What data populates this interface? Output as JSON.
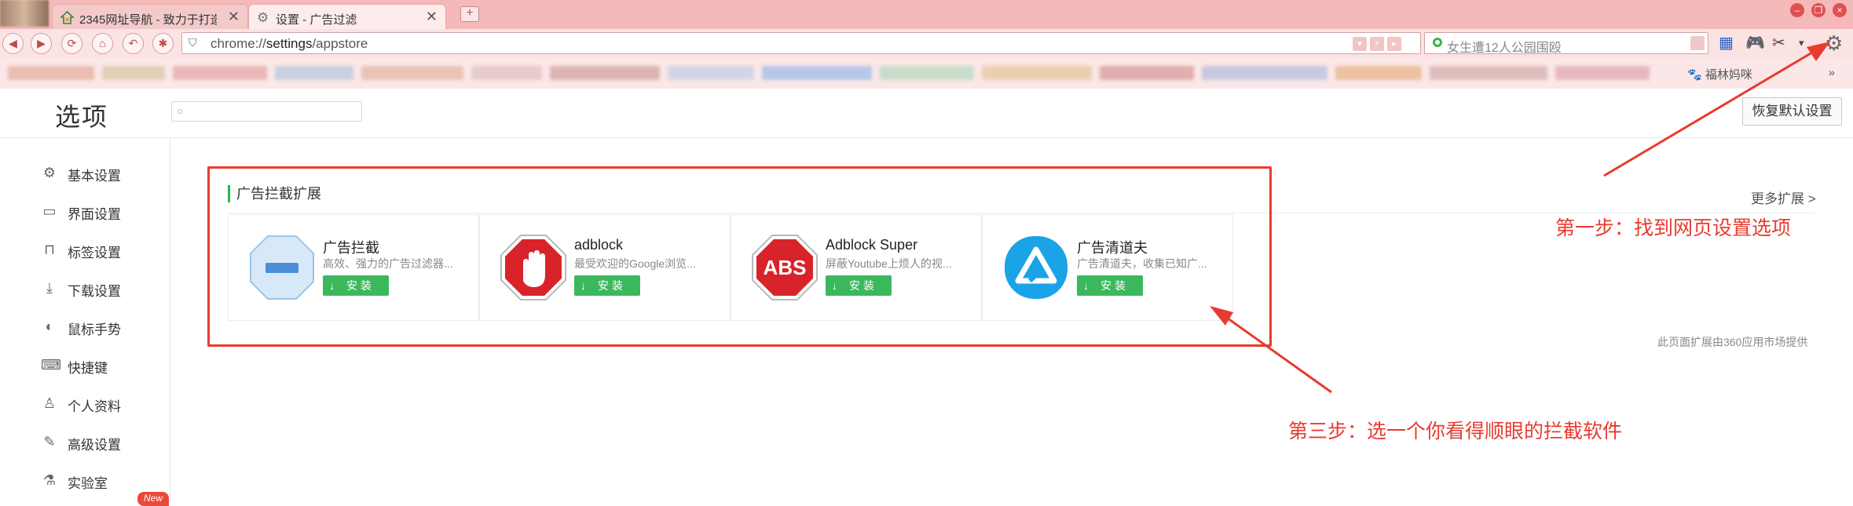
{
  "browser": {
    "tabs": [
      {
        "title": "2345网址导航 - 致力于打造",
        "icon": "2345-icon"
      },
      {
        "title": "设置 - 广告过滤",
        "icon": "gear-icon"
      }
    ],
    "new_tab_symbol": "+",
    "window_controls": [
      "–",
      "❐",
      "×"
    ],
    "nav_glyphs": {
      "back": "◀",
      "forward": "▶",
      "reload": "⟳",
      "home": "⌂",
      "undo": "↶",
      "favorite": "✱"
    },
    "url_parts": {
      "scheme": "chrome://",
      "host": "settings",
      "path": "/appstore"
    },
    "search_placeholder": "女生遭12人公园围殴",
    "bookmarks_visible": [
      {
        "label": "福林妈咪",
        "icon": "paw-icon"
      }
    ]
  },
  "settings": {
    "page_title": "选项",
    "search_placeholder": "",
    "restore_button": "恢复默认设置",
    "sidebar": [
      {
        "label": "基本设置",
        "icon": "gear-icon",
        "glyph": "⚙"
      },
      {
        "label": "界面设置",
        "icon": "window-icon",
        "glyph": "▭"
      },
      {
        "label": "标签设置",
        "icon": "tab-icon",
        "glyph": "⊓"
      },
      {
        "label": "下载设置",
        "icon": "download-icon",
        "glyph": "⤓"
      },
      {
        "label": "鼠标手势",
        "icon": "mouse-icon",
        "glyph": "◐"
      },
      {
        "label": "快捷键",
        "icon": "keyboard-icon",
        "glyph": "⌨"
      },
      {
        "label": "个人资料",
        "icon": "user-icon",
        "glyph": "♙"
      },
      {
        "label": "高级设置",
        "icon": "wrench-icon",
        "glyph": "✎"
      },
      {
        "label": "实验室",
        "icon": "flask-icon",
        "glyph": "⚗"
      }
    ],
    "new_badge": "New",
    "section_title": "广告拦截扩展",
    "more_link": "更多扩展 >",
    "extensions": [
      {
        "name": "广告拦截",
        "desc": "高效、强力的广告过滤器...",
        "install": "安装",
        "icon": "adblock-minus-icon",
        "color": "#4a8fd8"
      },
      {
        "name": "adblock",
        "desc": "最受欢迎的Google浏览...",
        "install": "安装",
        "icon": "stop-hand-icon",
        "color": "#d9232a"
      },
      {
        "name": "Adblock Super",
        "desc": "屏蔽Youtube上烦人的视...",
        "install": "安装",
        "icon": "abs-stop-icon",
        "color": "#d9232a",
        "logo_text": "ABS"
      },
      {
        "name": "广告清道夫",
        "desc": "广告清道夫，收集已知广...",
        "install": "安装",
        "icon": "triangle-logo-icon",
        "color": "#1aa3e6"
      }
    ],
    "provider_note": "此页面扩展由360应用市场提供"
  },
  "annotations": {
    "step1": "第一步：找到网页设置选项",
    "step3": "第三步：选一个你看得顺眼的拦截软件",
    "color": "#e83b30"
  }
}
